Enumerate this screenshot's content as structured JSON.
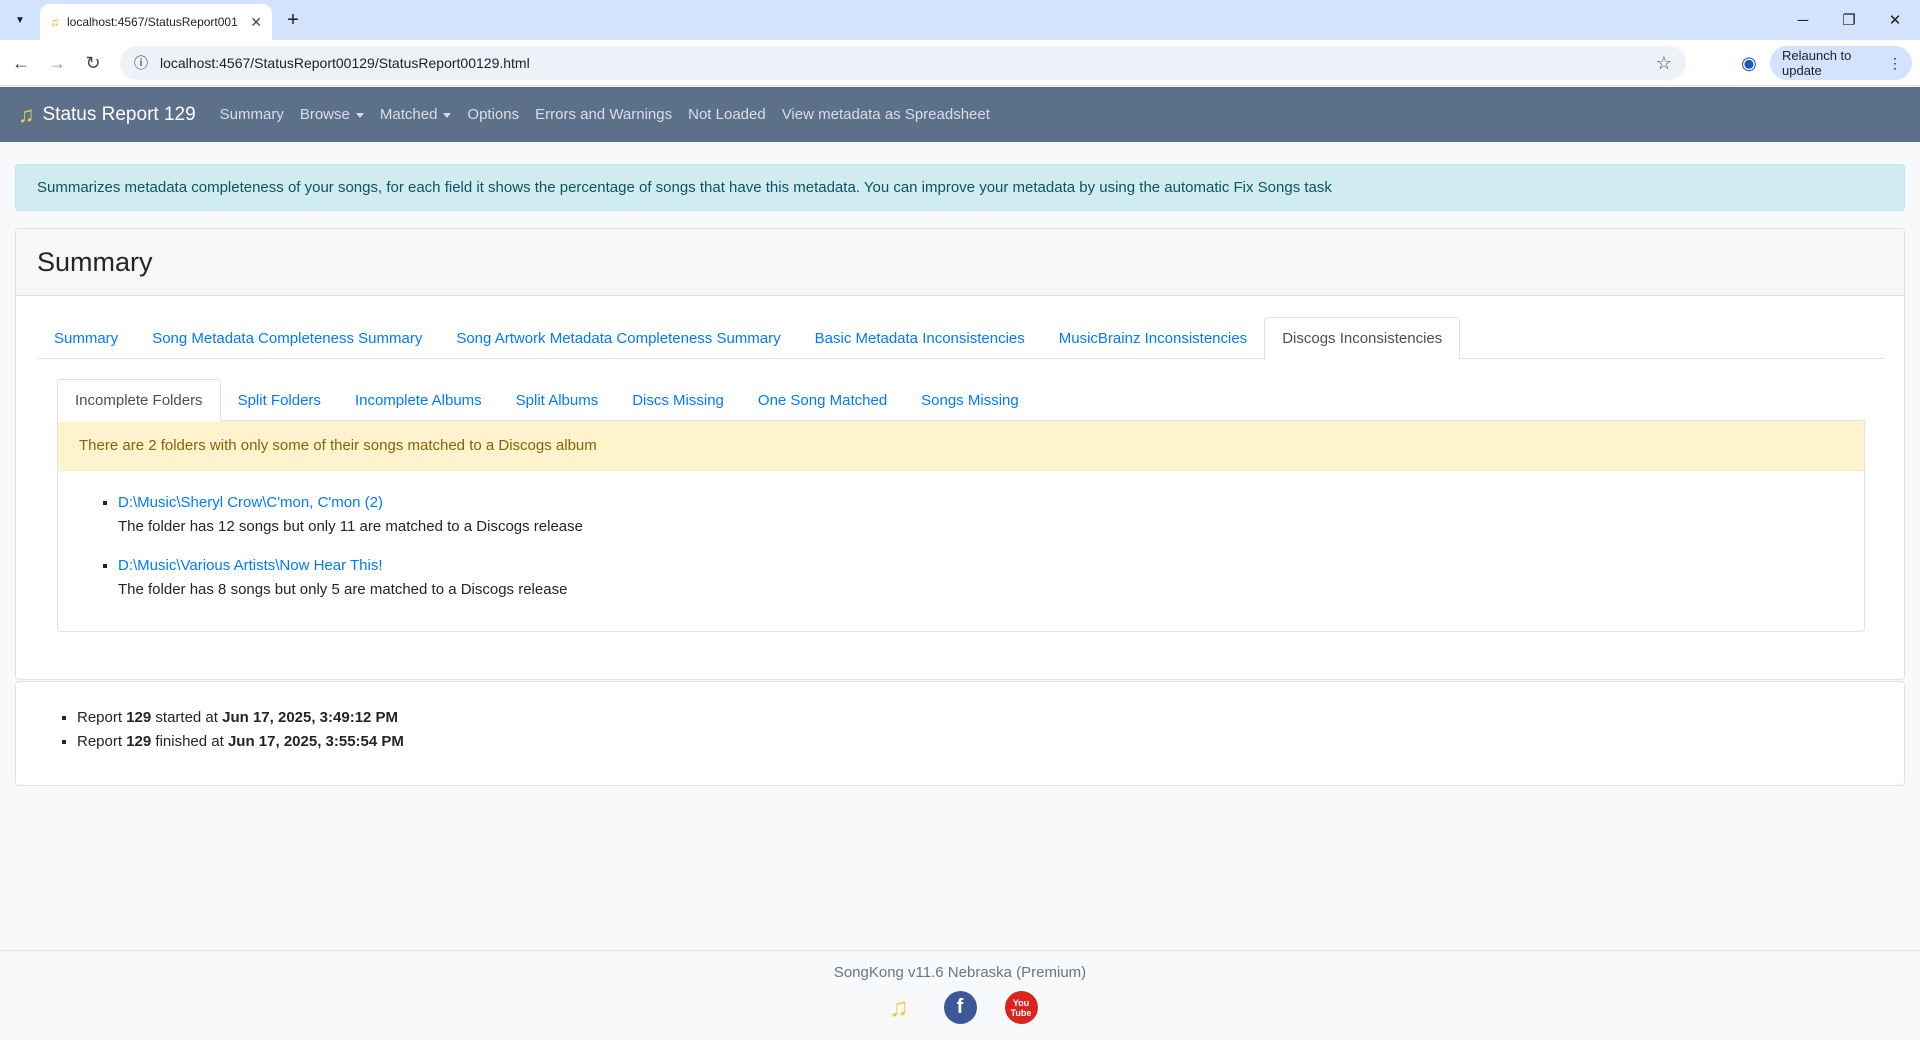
{
  "browser": {
    "tab_title": "localhost:4567/StatusReport001",
    "url": "localhost:4567/StatusReport00129/StatusReport00129.html",
    "relaunch_label": "Relaunch to update"
  },
  "navbar": {
    "brand": "Status Report 129",
    "links": {
      "summary": "Summary",
      "browse": "Browse",
      "matched": "Matched",
      "options": "Options",
      "errors": "Errors and Warnings",
      "not_loaded": "Not Loaded",
      "spreadsheet": "View metadata as Spreadsheet"
    }
  },
  "info_banner": "Summarizes metadata completeness of your songs, for each field it shows the percentage of songs that have this metadata. You can improve your metadata by using the automatic Fix Songs task",
  "card": {
    "title": "Summary",
    "tabs": [
      "Summary",
      "Song Metadata Completeness Summary",
      "Song Artwork Metadata Completeness Summary",
      "Basic Metadata Inconsistencies",
      "MusicBrainz Inconsistencies",
      "Discogs Inconsistencies"
    ],
    "subtabs": [
      "Incomplete Folders",
      "Split Folders",
      "Incomplete Albums",
      "Split Albums",
      "Discs Missing",
      "One Song Matched",
      "Songs Missing"
    ],
    "warning": "There are 2 folders with only some of their songs matched to a Discogs album",
    "folders": [
      {
        "path": "D:\\Music\\Sheryl Crow\\C'mon, C'mon (2)",
        "desc": "The folder has 12 songs but only 11 are matched to a Discogs release"
      },
      {
        "path": "D:\\Music\\Various Artists\\Now Hear This!",
        "desc": "The folder has 8 songs but only 5 are matched to a Discogs release"
      }
    ]
  },
  "report": {
    "word": "Report",
    "number": "129",
    "started_text": "started at",
    "started_at": "Jun 17, 2025, 3:49:12 PM",
    "finished_text": "finished at",
    "finished_at": "Jun 17, 2025, 3:55:54 PM"
  },
  "footer": {
    "version": "SongKong v11.6 Nebraska (Premium)",
    "icons": [
      "songkong-icon",
      "facebook-icon",
      "youtube-icon"
    ]
  }
}
